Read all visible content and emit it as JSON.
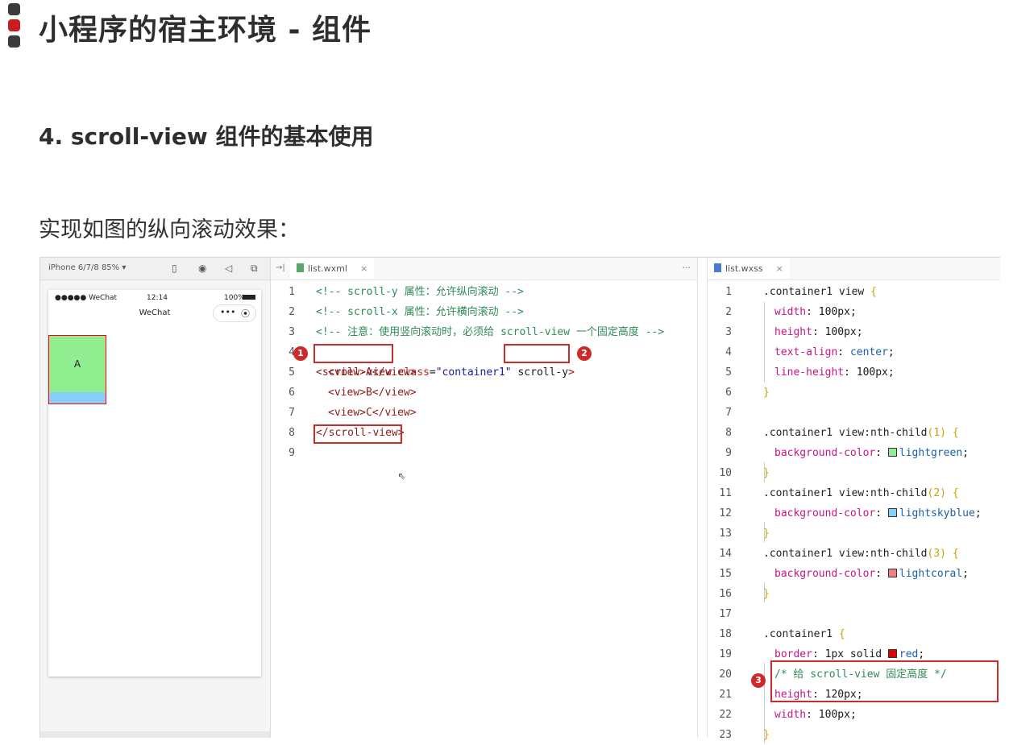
{
  "page_title": "小程序的宿主环境 - 组件",
  "section_title": "4. scroll-view 组件的基本使用",
  "description": "实现如图的纵向滚动效果：",
  "simulator": {
    "device": "iPhone 6/7/8 85% ▾",
    "carrier": "●●●●● WeChat",
    "time": "12:14",
    "battery": "100%",
    "nav_title": "WeChat",
    "capsule_more": "•••",
    "capsule_close": "⦿",
    "view_a": "A"
  },
  "wxml": {
    "tab": "list.wxml",
    "tab_close": "×",
    "more": "···",
    "lines": [
      "1",
      "2",
      "3",
      "4",
      "5",
      "6",
      "7",
      "8",
      "9"
    ],
    "code": {
      "l1": "<!-- scroll-y 属性：允许纵向滚动 -->",
      "l2": "<!-- scroll-x 属性：允许横向滚动 -->",
      "l3": "<!-- 注意：使用竖向滚动时，必须给 scroll-view 一个固定高度 -->",
      "l4_tag": "<scroll-view",
      "l4_attr": " class",
      "l4_eq": "=",
      "l4_val": "\"container1\"",
      "l4_sy": " scroll-y",
      "l4_end": ">",
      "l5": "<view>A</view>",
      "l6": "<view>B</view>",
      "l7": "<view>C</view>",
      "l8": "</scroll-view>"
    },
    "badges": [
      "1",
      "2"
    ]
  },
  "wxss": {
    "tab": "list.wxss",
    "tab_close": "×",
    "lines": [
      "1",
      "2",
      "3",
      "4",
      "5",
      "6",
      "7",
      "8",
      "9",
      "10",
      "11",
      "12",
      "13",
      "14",
      "15",
      "16",
      "17",
      "18",
      "19",
      "20",
      "21",
      "22",
      "23"
    ],
    "code": {
      "l1_sel": ".container1 view ",
      "l2_p": "width",
      "l2_v": "100px",
      "l3_p": "height",
      "l3_v": "100px",
      "l4_p": "text-align",
      "l4_v": "center",
      "l5_p": "line-height",
      "l5_v": "100px",
      "l8_sel": ".container1 view:nth-child",
      "l8_arg": "(1)",
      "l9_p": "background-color",
      "l9_v": "lightgreen",
      "l11_sel": ".container1 view:nth-child",
      "l11_arg": "(2)",
      "l12_p": "background-color",
      "l12_v": "lightskyblue",
      "l14_sel": ".container1 view:nth-child",
      "l14_arg": "(3)",
      "l15_p": "background-color",
      "l15_v": "lightcoral",
      "l18_sel": ".container1 ",
      "l19_p": "border",
      "l19_v": "1px solid ",
      "l19_c": "red",
      "l20": "/* 给 scroll-view 固定高度 */",
      "l21_p": "height",
      "l21_v": "120px",
      "l22_p": "width",
      "l22_v": "100px",
      "open": "{",
      "close": "}",
      "colon": ": ",
      "semi": ";"
    },
    "badges": [
      "3"
    ]
  },
  "colors": {
    "lightgreen": "#90ee90",
    "lightskyblue": "#87cefa",
    "lightcoral": "#f08080",
    "red": "#ff0000",
    "highlight": "#cc2b2b"
  }
}
